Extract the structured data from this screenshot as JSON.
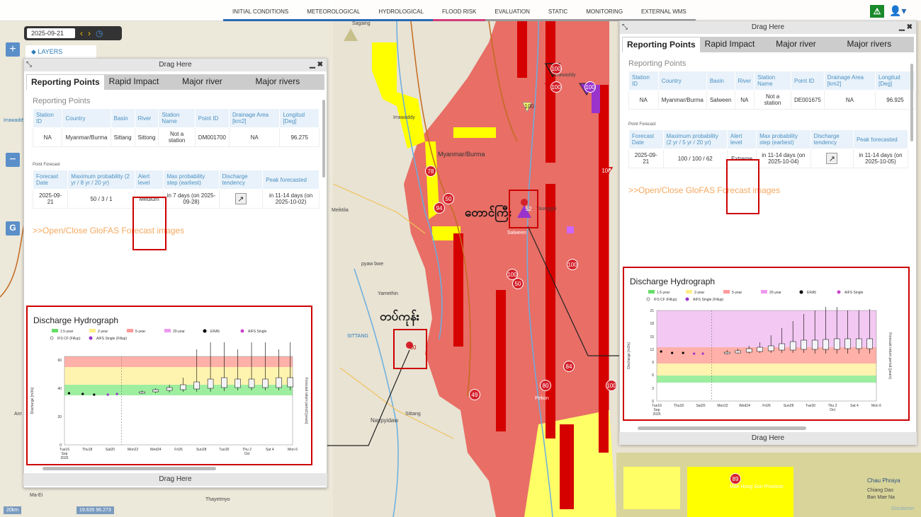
{
  "nav": {
    "tabs": [
      "INITIAL CONDITIONS",
      "METEOROLOGICAL",
      "HYDROLOGICAL",
      "FLOOD RISK",
      "EVALUATION",
      "STATIC",
      "MONITORING",
      "EXTERNAL WMS"
    ],
    "tab_colors": [
      "#2a6ab5",
      "#2a6ab5",
      "#2a6ab5",
      "#d23c7b",
      "#999",
      "#999",
      "#999",
      "#999"
    ]
  },
  "date": {
    "value": "2025-09-21"
  },
  "layers_label": "LAYERS",
  "map": {
    "places": [
      "Sagaing",
      "Irrawaddy",
      "Irrawaddy",
      "Myanmar/Burma",
      "Meiktila",
      "pyaw bwe",
      "Yamethin",
      "Naypyidaw",
      "Sittang",
      "SITTANG",
      "Salween",
      "Taunggyi",
      "Pekon",
      "Chau Phraya",
      "Chiang Dao",
      "Ban Mae Na",
      "Mae Hong Son Province",
      "Ma-Ei",
      "Thayetmyo",
      "Anr",
      "Irrawaddy"
    ],
    "burmese": [
      "တောင်ကြီး",
      "တပ်ကုန်း"
    ],
    "badges": [
      "100",
      "100",
      "100",
      "78",
      "50",
      "94",
      "52",
      "100",
      "50",
      "100",
      "84",
      "80",
      "49",
      "100",
      "30",
      "89",
      "100",
      "100",
      "100"
    ],
    "scale": "20km",
    "coords": "19.635  96.273",
    "disclaimer": "Disclaimer"
  },
  "left_panel": {
    "drag_label": "Drag Here",
    "tabs": [
      "Reporting Points",
      "Rapid Impact",
      "Major river",
      "Major rivers"
    ],
    "section": "Reporting Points",
    "station_headers": [
      "Station ID",
      "Country",
      "Basin",
      "River",
      "Station Name",
      "Point ID",
      "Drainage Area [km2]",
      "Longitud [Deg]"
    ],
    "station_row": [
      "NA",
      "Myanmar/Burma",
      "Sittang",
      "Sittong",
      "Not a station",
      "DM001700",
      "NA",
      "96.275"
    ],
    "forecast_label": "Point Forecast",
    "forecast_headers": [
      "Forecast Date",
      "Maximum probability (2 yr / 8 yr / 20 yr)",
      "Alert level",
      "Max probability step (earliest)",
      "Discharge tendency",
      "Peak forecasted"
    ],
    "forecast_row": [
      "2025-09-21",
      "50 / 3 / 1",
      "Medium",
      "in 7 days (on 2025-09-28)",
      "",
      "in 11-14 days (on 2025-10-02)"
    ],
    "glofas_link": ">>Open/Close GloFAS Forecast images",
    "hydro_title": "Discharge Hydrograph",
    "legend": [
      "1.5-year",
      "2-year",
      "5-year",
      "20-year",
      "ERA5",
      "AIFS Single",
      "IFS CF (Fillup)",
      "AIFS Single (Fillup)"
    ],
    "ylabel": "Discharge [m3/s]",
    "y2label": "Forecast return period [years]",
    "yticks": [
      "60",
      "40",
      "20",
      "0"
    ],
    "xticks": [
      "Tue16\nSep\n2025",
      "Thu18",
      "Sat20",
      "Mon22",
      "Wed24",
      "Fri26",
      "Sun28",
      "Tue30",
      "Thu 2\nOct",
      "Sat 4",
      "Mon 6"
    ],
    "footer": "Drag Here"
  },
  "right_panel": {
    "drag_label": "Drag Here",
    "tabs": [
      "Reporting Points",
      "Rapid Impact",
      "Major river",
      "Major rivers"
    ],
    "section": "Reporting Points",
    "station_headers": [
      "Station ID",
      "Country",
      "Basin",
      "River",
      "Station Name",
      "Point ID",
      "Drainage Area [km2]",
      "Longitud [Deg]"
    ],
    "station_row": [
      "NA",
      "Myanmar/Burma",
      "Salween",
      "NA",
      "Not a station",
      "DE001675",
      "NA",
      "96.925"
    ],
    "forecast_label": "Point Forecast",
    "forecast_headers": [
      "Forecast Date",
      "Maximum probability (2 yr / 5 yr / 20 yr)",
      "Alert level",
      "Max probability step (earliest)",
      "Discharge tendency",
      "Peak forecasted"
    ],
    "forecast_row": [
      "2025-09-21",
      "100 / 100 / 62",
      "Extreme",
      "in 11-14 days (on 2025-10-04)",
      "",
      "in 11-14 days (on 2025-10-05)"
    ],
    "glofas_link": ">>Open/Close GloFAS Forecast images",
    "hydro_title": "Discharge Hydrograph",
    "legend": [
      "1.5-year",
      "2-year",
      "5-year",
      "20-year",
      "ERA5",
      "AIFS Single",
      "IFS CF (Fillup)",
      "AIFS Single (Fillup)"
    ],
    "ylabel": "Discharge [m3/s]",
    "y2label": "Forecast return period [years]",
    "yticks": [
      "21",
      "18",
      "15",
      "12",
      "9",
      "6",
      "3",
      "0"
    ],
    "xticks": [
      "Tue16\nSep\n2025",
      "Thu18",
      "Sat20",
      "Mon22",
      "Wed24",
      "Fri26",
      "Sun28",
      "Tue30",
      "Thu 2\nOct",
      "Sat 4",
      "Mon 6"
    ],
    "footer": "Drag Here"
  },
  "colors": {
    "alert_red": "#cc0000",
    "flood_red": "#e8605a",
    "deep_red": "#d50000",
    "yellow": "#ffff00",
    "purple": "#9933cc",
    "link_orange": "#f5a860",
    "header_blue": "#4a90c2"
  }
}
